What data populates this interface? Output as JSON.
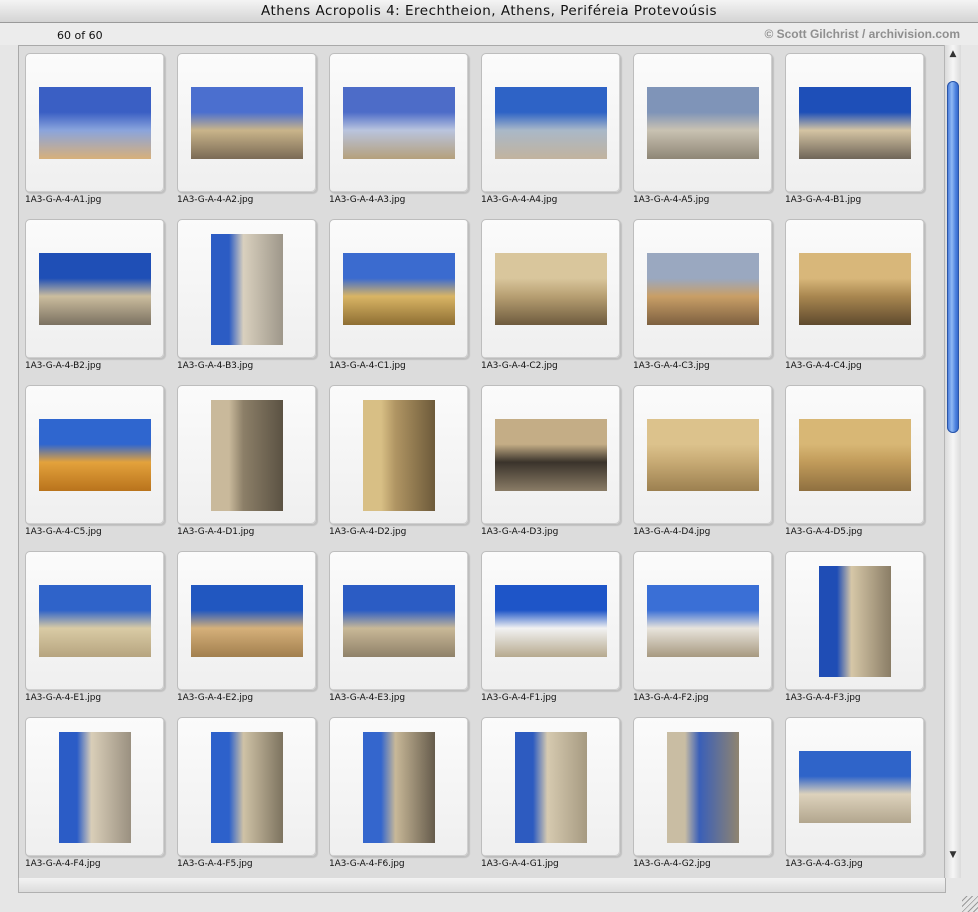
{
  "window": {
    "title": "Athens Acropolis 4: Erechtheion, Athens, Periféreia Protevoúsis",
    "count": "60 of 60",
    "credit": "© Scott Gilchrist / archivision.com"
  },
  "thumbnails": [
    {
      "file": "1A3-G-A-4-A1.jpg",
      "orientation": "landscape",
      "palette": [
        "#3a5fc4",
        "#8aa4dc",
        "#d8b07a"
      ]
    },
    {
      "file": "1A3-G-A-4-A2.jpg",
      "orientation": "landscape",
      "palette": [
        "#4b6fcf",
        "#c9b48a",
        "#7a6a55"
      ]
    },
    {
      "file": "1A3-G-A-4-A3.jpg",
      "orientation": "landscape",
      "palette": [
        "#4d6cc8",
        "#b9c4de",
        "#b5a07b"
      ]
    },
    {
      "file": "1A3-G-A-4-A4.jpg",
      "orientation": "landscape",
      "palette": [
        "#2e63c6",
        "#a9b8c8",
        "#c2b39e"
      ]
    },
    {
      "file": "1A3-G-A-4-A5.jpg",
      "orientation": "landscape",
      "palette": [
        "#7f94b8",
        "#c9c2b2",
        "#8e8676"
      ]
    },
    {
      "file": "1A3-G-A-4-B1.jpg",
      "orientation": "landscape",
      "palette": [
        "#1e4fb8",
        "#d4c4a3",
        "#6f6558"
      ]
    },
    {
      "file": "1A3-G-A-4-B2.jpg",
      "orientation": "landscape",
      "palette": [
        "#1f4fb6",
        "#cbbd9e",
        "#7b7161"
      ]
    },
    {
      "file": "1A3-G-A-4-B3.jpg",
      "orientation": "portrait",
      "palette": [
        "#2c5cc4",
        "#d9d0be",
        "#9e978a"
      ]
    },
    {
      "file": "1A3-G-A-4-C1.jpg",
      "orientation": "landscape",
      "palette": [
        "#3b6bcf",
        "#d9b565",
        "#8e6e33"
      ]
    },
    {
      "file": "1A3-G-A-4-C2.jpg",
      "orientation": "landscape",
      "palette": [
        "#d9c69c",
        "#b79f72",
        "#6e5b3e"
      ]
    },
    {
      "file": "1A3-G-A-4-C3.jpg",
      "orientation": "landscape",
      "palette": [
        "#9aa8c0",
        "#c99f67",
        "#7d6040"
      ]
    },
    {
      "file": "1A3-G-A-4-C4.jpg",
      "orientation": "landscape",
      "palette": [
        "#d8b77a",
        "#a98750",
        "#5f4a2e"
      ]
    },
    {
      "file": "1A3-G-A-4-C5.jpg",
      "orientation": "landscape",
      "palette": [
        "#2f66cf",
        "#e3a23c",
        "#b9731c"
      ]
    },
    {
      "file": "1A3-G-A-4-D1.jpg",
      "orientation": "portrait",
      "palette": [
        "#c9b99b",
        "#8c7f68",
        "#5b5243"
      ]
    },
    {
      "file": "1A3-G-A-4-D2.jpg",
      "orientation": "portrait",
      "palette": [
        "#d8bf85",
        "#b09563",
        "#6d5a3a"
      ]
    },
    {
      "file": "1A3-G-A-4-D3.jpg",
      "orientation": "landscape",
      "palette": [
        "#c4ad86",
        "#3a332b",
        "#8a7c66"
      ]
    },
    {
      "file": "1A3-G-A-4-D4.jpg",
      "orientation": "landscape",
      "palette": [
        "#dcc28c",
        "#c7aa74",
        "#9c8050"
      ]
    },
    {
      "file": "1A3-G-A-4-D5.jpg",
      "orientation": "landscape",
      "palette": [
        "#d8b775",
        "#c19b5a",
        "#8f7040"
      ]
    },
    {
      "file": "1A3-G-A-4-E1.jpg",
      "orientation": "landscape",
      "palette": [
        "#2f63c9",
        "#d9cba5",
        "#b6a47f"
      ]
    },
    {
      "file": "1A3-G-A-4-E2.jpg",
      "orientation": "landscape",
      "palette": [
        "#2157c0",
        "#d5b07a",
        "#a27f4e"
      ]
    },
    {
      "file": "1A3-G-A-4-E3.jpg",
      "orientation": "landscape",
      "palette": [
        "#2b5cc4",
        "#c8b897",
        "#8f8169"
      ]
    },
    {
      "file": "1A3-G-A-4-F1.jpg",
      "orientation": "landscape",
      "palette": [
        "#1e55c8",
        "#f2f2f2",
        "#b6a98e"
      ]
    },
    {
      "file": "1A3-G-A-4-F2.jpg",
      "orientation": "landscape",
      "palette": [
        "#3a6fd6",
        "#e8e4dc",
        "#a79980"
      ]
    },
    {
      "file": "1A3-G-A-4-F3.jpg",
      "orientation": "portrait",
      "palette": [
        "#1f4db5",
        "#d6c7a7",
        "#8a7d66"
      ]
    },
    {
      "file": "1A3-G-A-4-F4.jpg",
      "orientation": "portrait",
      "palette": [
        "#2b5cc6",
        "#d9ceb8",
        "#9a9080"
      ]
    },
    {
      "file": "1A3-G-A-4-F5.jpg",
      "orientation": "portrait",
      "palette": [
        "#2d61cb",
        "#cfc2a6",
        "#7d735f"
      ]
    },
    {
      "file": "1A3-G-A-4-F6.jpg",
      "orientation": "portrait",
      "palette": [
        "#3466cd",
        "#c8b898",
        "#655b4b"
      ]
    },
    {
      "file": "1A3-G-A-4-G1.jpg",
      "orientation": "portrait",
      "palette": [
        "#2d5bc0",
        "#d6cab0",
        "#a69a81"
      ]
    },
    {
      "file": "1A3-G-A-4-G2.jpg",
      "orientation": "portrait",
      "palette": [
        "#c9bda3",
        "#3a5fb8",
        "#8f8470"
      ]
    },
    {
      "file": "1A3-G-A-4-G3.jpg",
      "orientation": "landscape",
      "palette": [
        "#2f64c9",
        "#ddd2bc",
        "#b2a68e"
      ]
    }
  ],
  "colors": {
    "window_bg": "#e6e6e6",
    "grid_bg": "#dcdcdc",
    "slide_bg": "#f4f4f4",
    "scroll_knob": "#3f72d6"
  }
}
